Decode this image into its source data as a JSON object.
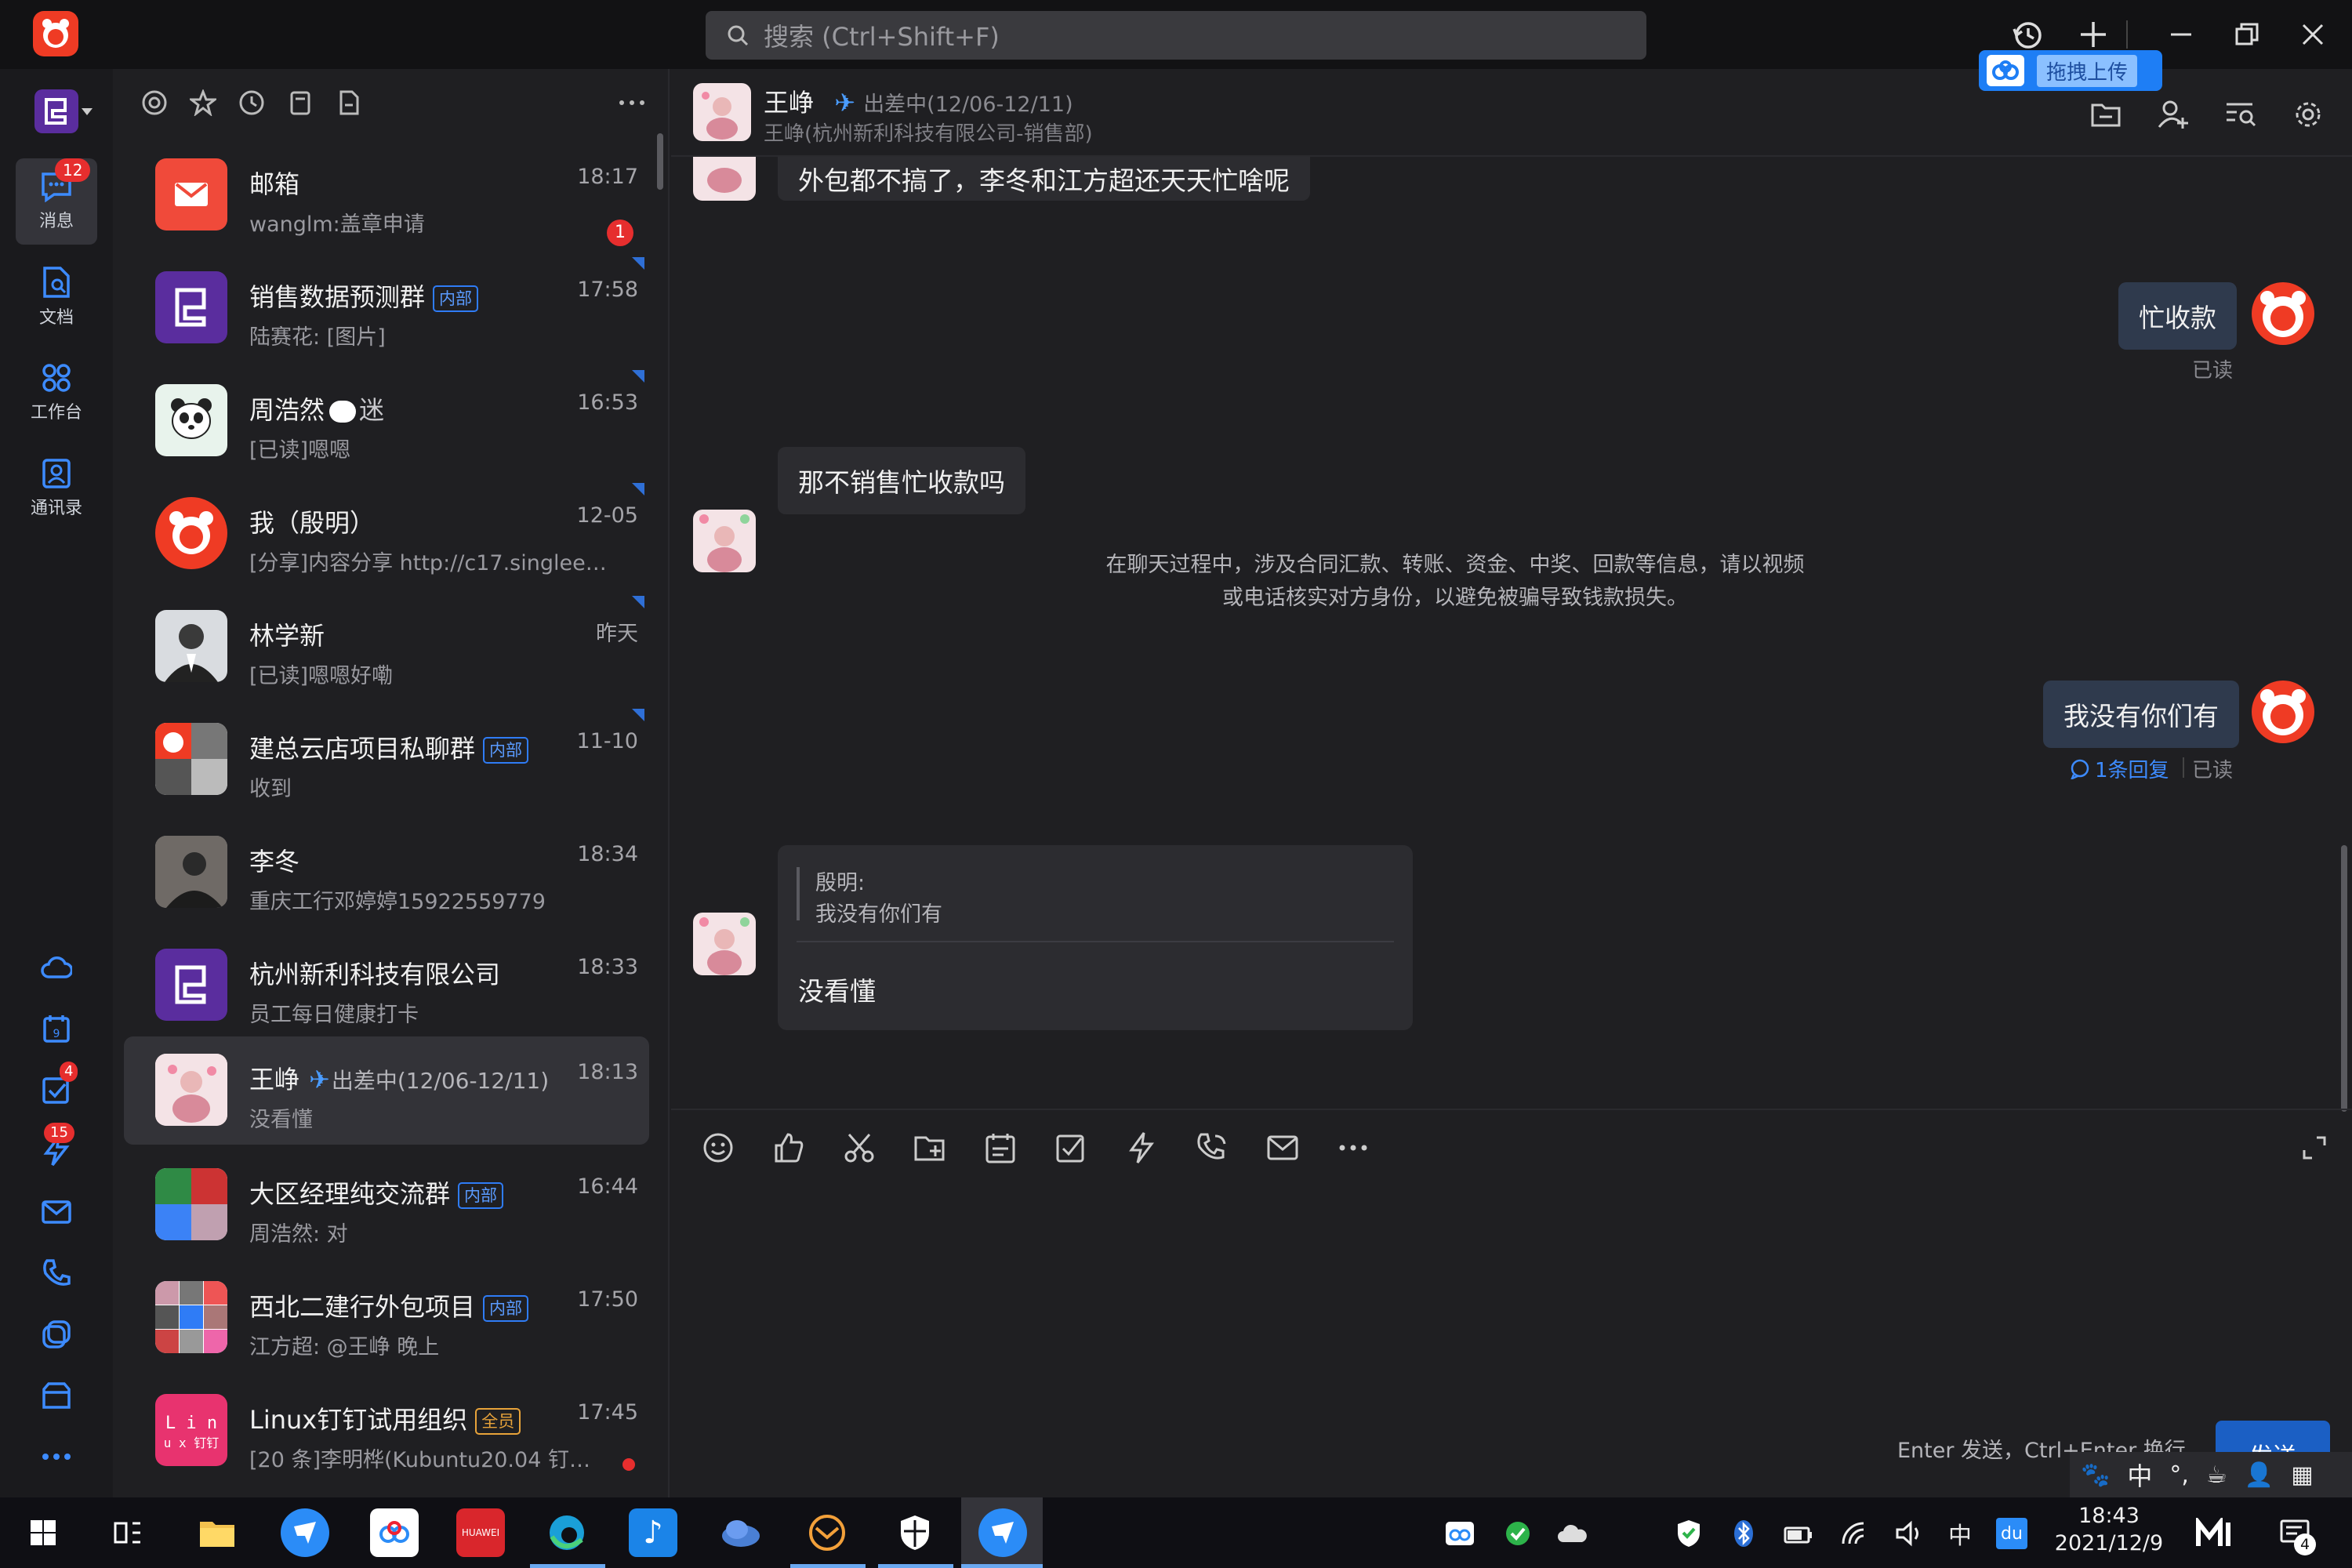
{
  "topbar": {
    "search_placeholder": "搜索 (Ctrl+Shift+F)",
    "upload_tooltip": "拖拽上传"
  },
  "rail": {
    "messages_label": "消息",
    "messages_badge": "12",
    "docs_label": "文档",
    "workbench_label": "工作台",
    "contacts_label": "通讯录",
    "todo_badge": "4",
    "ding_badge": "15"
  },
  "conversations": [
    {
      "name": "邮箱",
      "preview": "wanglm:盖章申请",
      "time": "18:17",
      "unread": "1"
    },
    {
      "name": "销售数据预测群",
      "tag": "内部",
      "preview": "陆赛花: [图片]",
      "time": "17:58"
    },
    {
      "name": "周浩然",
      "status": "迷",
      "preview": "[已读]嗯嗯",
      "time": "16:53"
    },
    {
      "name": "我（殷明）",
      "preview": "[分享]内容分享 http://c17.singlee....",
      "time": "12-05"
    },
    {
      "name": "林学新",
      "preview": "[已读]嗯嗯好嘞",
      "time": "昨天"
    },
    {
      "name": "建总云店项目私聊群",
      "tag": "内部",
      "preview": "收到",
      "time": "11-10"
    },
    {
      "name": "李冬",
      "preview": "重庆工行邓婷婷15922559779",
      "time": "18:34"
    },
    {
      "name": "杭州新利科技有限公司",
      "preview": "员工每日健康打卡",
      "time": "18:33"
    },
    {
      "name": "王峥",
      "status": "出差中(12/06-12/11)",
      "preview": "没看懂",
      "time": "18:13"
    },
    {
      "name": "大区经理纯交流群",
      "tag": "内部",
      "preview": "周浩然: 对",
      "time": "16:44"
    },
    {
      "name": "西北二建行外包项目",
      "tag": "内部",
      "preview": "江方超: @王峥 晚上",
      "time": "17:50"
    },
    {
      "name": "Linux钉钉试用组织",
      "tag": "全员",
      "preview": "[20 条]李明桦(Kubuntu20.04 钉钉...",
      "time": "17:45"
    }
  ],
  "chat": {
    "contact_name": "王峥",
    "contact_status": "出差中(12/06-12/11)",
    "contact_org": "王峥(杭州新利科技有限公司-销售部)",
    "messages": {
      "m1": "外包都不搞了，李冬和江方超还天天忙啥呢",
      "m2": "忙收款",
      "m2_read": "已读",
      "m3": "那不销售忙收款吗",
      "notice_line1": "在聊天过程中，涉及合同汇款、转账、资金、中奖、回款等信息，请以视频",
      "notice_line2": "或电话核实对方身份，以避免被骗导致钱款损失。",
      "m4": "我没有你们有",
      "m4_reply": "1条回复",
      "m4_read": "已读",
      "quote_sender": "殷明:",
      "quote_text": "我没有你们有",
      "m5": "没看懂"
    },
    "composer_hint": "Enter 发送，Ctrl+Enter 换行",
    "send_label": "发送"
  },
  "taskbar": {
    "ime_label": "中",
    "tray_ime": "中",
    "clock_time": "18:43",
    "clock_date": "2021/12/9",
    "notify_count": "4"
  },
  "colors": {
    "accent": "#2f7cf6",
    "badge_red": "#e62e2e",
    "logo_red": "#ef3b24",
    "bubble_self": "#2f3a4d",
    "bubble_other": "#2c2c30"
  }
}
